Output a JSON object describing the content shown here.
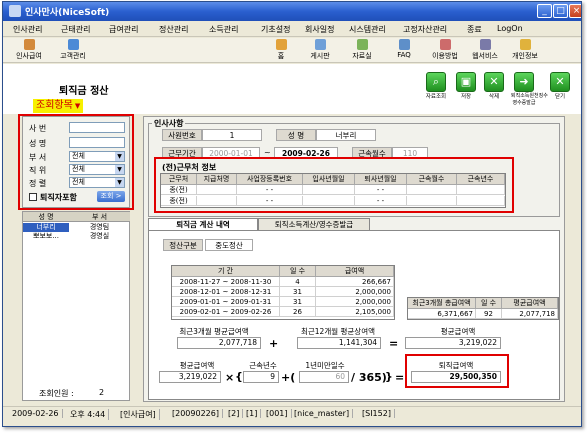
{
  "window": {
    "title": "인사만사(NiceSoft)",
    "min": "_",
    "max": "□",
    "close": "×"
  },
  "menu": [
    "인사관리",
    "근태관리",
    "급여관리",
    "정산관리",
    "소득관리",
    "기초설정",
    "회사일정",
    "시스템관리",
    "고정자산관리",
    "종료",
    "LogOn"
  ],
  "toolbar": {
    "left": [
      "인사급여",
      "고객관리"
    ],
    "right": [
      "홈",
      "게시판",
      "자료실",
      "FAQ",
      "이용방법",
      "웹서비스",
      "개인정보"
    ]
  },
  "page": {
    "title": "퇴직금 정산",
    "annotation": "조회항목",
    "arrow": "▼"
  },
  "actions": [
    "자료조회",
    "저장",
    "삭제",
    "퇴직소득원천징수\n영수증발급",
    "닫기"
  ],
  "search": {
    "labels": [
      "사 번",
      "성 명",
      "부 서",
      "직 위",
      "정 렬"
    ],
    "values": [
      "",
      "",
      "전체",
      "전체",
      "전체"
    ],
    "checkbox": "퇴직자포함",
    "button": "조회 >"
  },
  "list": {
    "headers": [
      "성 명",
      "부 서"
    ],
    "rows": [
      [
        "너부리",
        "경영팀"
      ],
      [
        "뽀보보...",
        "경영실"
      ]
    ],
    "count_label": "조회인원 :",
    "count": "2"
  },
  "employee": {
    "section": "인사사항",
    "emp_no_label": "사원번호",
    "emp_no": "1",
    "name_label": "성 명",
    "name": "너부리",
    "period_label": "근무기간",
    "start": "2000-01-01",
    "end": "2009-02-26",
    "tenure_label": "근속월수",
    "tenure": "110"
  },
  "prev_work": {
    "section": "(전)근무처 정보",
    "headers": [
      "근무처",
      "지급처명",
      "사업장등록번호",
      "입사년월일",
      "퇴사년월일",
      "근속월수",
      "근속년수"
    ],
    "rows": [
      [
        "종(전)",
        "",
        "- -",
        "",
        "- -",
        "",
        ""
      ],
      [
        "종(전)",
        "",
        "- -",
        "",
        "- -",
        "",
        ""
      ]
    ]
  },
  "tabs": [
    "퇴직금 계산 내역",
    "퇴직소득계산/영수증발급"
  ],
  "calc": {
    "type_label": "정산구분",
    "type_value": "중도정산",
    "pay_headers": [
      "기 간",
      "일 수",
      "급여액"
    ],
    "pay_rows": [
      [
        "2008-11-27 ~ 2008-11-30",
        "4",
        "266,667"
      ],
      [
        "2008-12-01 ~ 2008-12-31",
        "31",
        "2,000,000"
      ],
      [
        "2009-01-01 ~ 2009-01-31",
        "31",
        "2,000,000"
      ],
      [
        "2009-02-01 ~ 2009-02-26",
        "26",
        "2,105,000"
      ]
    ],
    "summary_headers": [
      "최근3개월 총급여액",
      "일 수",
      "평균급여액"
    ],
    "summary_values": [
      "6,371,667",
      "92",
      "2,077,718"
    ],
    "f1_label": "최근3개월 평균급여액",
    "f1": "2,077,718",
    "f2_label": "최근12개월 평균상여액",
    "f2": "1,141,304",
    "f3_label": "평균급여액",
    "f3": "3,219,022",
    "avg_label": "평균급여액",
    "avg": "3,219,022",
    "years_label": "근속년수",
    "years": "9",
    "frac_label": "1년미만일수",
    "frac": "60",
    "denom": "/ 365)",
    "result_label": "퇴직급여액",
    "result": "29,500,350",
    "ops": [
      "+",
      "=",
      "×",
      "{",
      "+(",
      "}",
      "="
    ]
  },
  "status": [
    "2009-02-26",
    "오후 4:44",
    "[인사급여]",
    "[20090226]",
    "[2]",
    "[1]",
    "[001]",
    "[nice_master]",
    "[SI152]"
  ]
}
